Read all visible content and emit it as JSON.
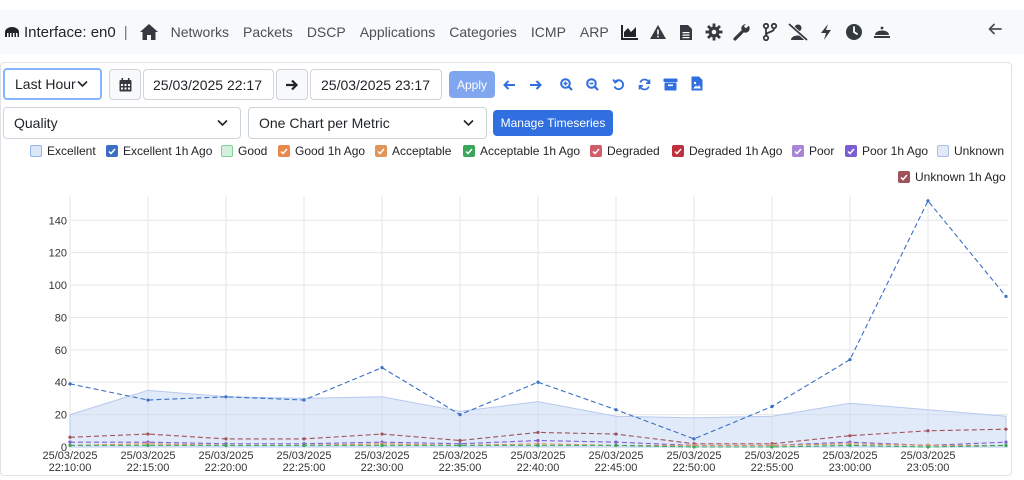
{
  "nav": {
    "interface_label": "Interface: en0",
    "separator": "|",
    "links": [
      "Networks",
      "Packets",
      "DSCP",
      "Applications",
      "Categories",
      "ICMP",
      "ARP"
    ],
    "icons": [
      "area-chart-icon",
      "warning-icon",
      "file-icon",
      "gear-icon",
      "wrench-icon",
      "branch-icon",
      "user-slash-icon",
      "bolt-icon",
      "clock-icon",
      "bell-icon"
    ]
  },
  "toolbar": {
    "range_select": "Last Hour",
    "start_datetime": "25/03/2025 22:17",
    "end_datetime": "25/03/2025 23:17",
    "apply_label": "Apply",
    "metric_select": "Quality",
    "layout_select": "One Chart per Metric",
    "manage_label": "Manage Timeseries"
  },
  "legend": [
    {
      "label": "Excellent",
      "checked": false,
      "color": "#93b4e8"
    },
    {
      "label": "Excellent 1h Ago",
      "checked": true,
      "color": "#3a6fc4"
    },
    {
      "label": "Good",
      "checked": false,
      "color": "#7fd19a"
    },
    {
      "label": "Good 1h Ago",
      "checked": true,
      "color": "#e8894b"
    },
    {
      "label": "Acceptable",
      "checked": true,
      "color": "#e0955a"
    },
    {
      "label": "Acceptable 1h Ago",
      "checked": true,
      "color": "#3aa65a"
    },
    {
      "label": "Degraded",
      "checked": true,
      "color": "#d35c6b"
    },
    {
      "label": "Degraded 1h Ago",
      "checked": true,
      "color": "#c0303d"
    },
    {
      "label": "Poor",
      "checked": true,
      "color": "#a885d6"
    },
    {
      "label": "Poor 1h Ago",
      "checked": true,
      "color": "#7c5ed0"
    },
    {
      "label": "Unknown",
      "checked": false,
      "color": "#a9bfe8"
    },
    {
      "label": "Unknown 1h Ago",
      "checked": true,
      "color": "#a0525a"
    }
  ],
  "chart_data": {
    "type": "area",
    "ylim": [
      0,
      155
    ],
    "yticks": [
      0,
      20,
      40,
      60,
      80,
      100,
      120,
      140
    ],
    "x": [
      "25/03/2025 22:10:00",
      "25/03/2025 22:15:00",
      "25/03/2025 22:20:00",
      "25/03/2025 22:25:00",
      "25/03/2025 22:30:00",
      "25/03/2025 22:35:00",
      "25/03/2025 22:40:00",
      "25/03/2025 22:45:00",
      "25/03/2025 22:50:00",
      "25/03/2025 22:55:00",
      "25/03/2025 23:00:00",
      "25/03/2025 23:05:00",
      "25/03/2025 23:10:00"
    ],
    "xtick_labels": [
      [
        "25/03/2025",
        "22:10:00"
      ],
      [
        "25/03/2025",
        "22:15:00"
      ],
      [
        "25/03/2025",
        "22:20:00"
      ],
      [
        "25/03/2025",
        "22:25:00"
      ],
      [
        "25/03/2025",
        "22:30:00"
      ],
      [
        "25/03/2025",
        "22:35:00"
      ],
      [
        "25/03/2025",
        "22:40:00"
      ],
      [
        "25/03/2025",
        "22:45:00"
      ],
      [
        "25/03/2025",
        "22:50:00"
      ],
      [
        "25/03/2025",
        "22:55:00"
      ],
      [
        "25/03/2025",
        "23:00:00"
      ],
      [
        "25/03/2025",
        "23:05:00"
      ]
    ],
    "grid": true,
    "series": [
      {
        "name": "Excellent",
        "style": "area",
        "color": "#c9d8f4",
        "values": [
          20,
          35,
          31,
          30,
          31,
          22,
          28,
          19,
          18,
          19,
          27,
          23,
          19
        ]
      },
      {
        "name": "Excellent 1h Ago",
        "style": "dashed",
        "color": "#3a6fc4",
        "values": [
          39,
          29,
          31,
          29,
          49,
          20,
          40,
          23,
          5,
          25,
          54,
          152,
          93
        ]
      },
      {
        "name": "Degraded 1h Ago",
        "style": "dashed",
        "color": "#a0525a",
        "values": [
          6,
          8,
          5,
          5,
          8,
          4,
          9,
          8,
          2,
          2,
          7,
          10,
          11
        ]
      },
      {
        "name": "Poor 1h Ago",
        "style": "dashed",
        "color": "#7c5ed0",
        "values": [
          3,
          3,
          2,
          2,
          3,
          2,
          4,
          3,
          1,
          1,
          3,
          1,
          3
        ]
      },
      {
        "name": "Acceptable",
        "style": "dashed",
        "color": "#e0955a",
        "values": [
          1,
          2,
          1,
          1,
          2,
          1,
          2,
          1,
          1,
          1,
          2,
          1,
          1
        ]
      },
      {
        "name": "Acceptable 1h Ago",
        "style": "dashed",
        "color": "#3aa65a",
        "values": [
          1,
          1,
          1,
          1,
          1,
          1,
          1,
          1,
          0,
          0,
          1,
          0,
          1
        ]
      }
    ]
  }
}
